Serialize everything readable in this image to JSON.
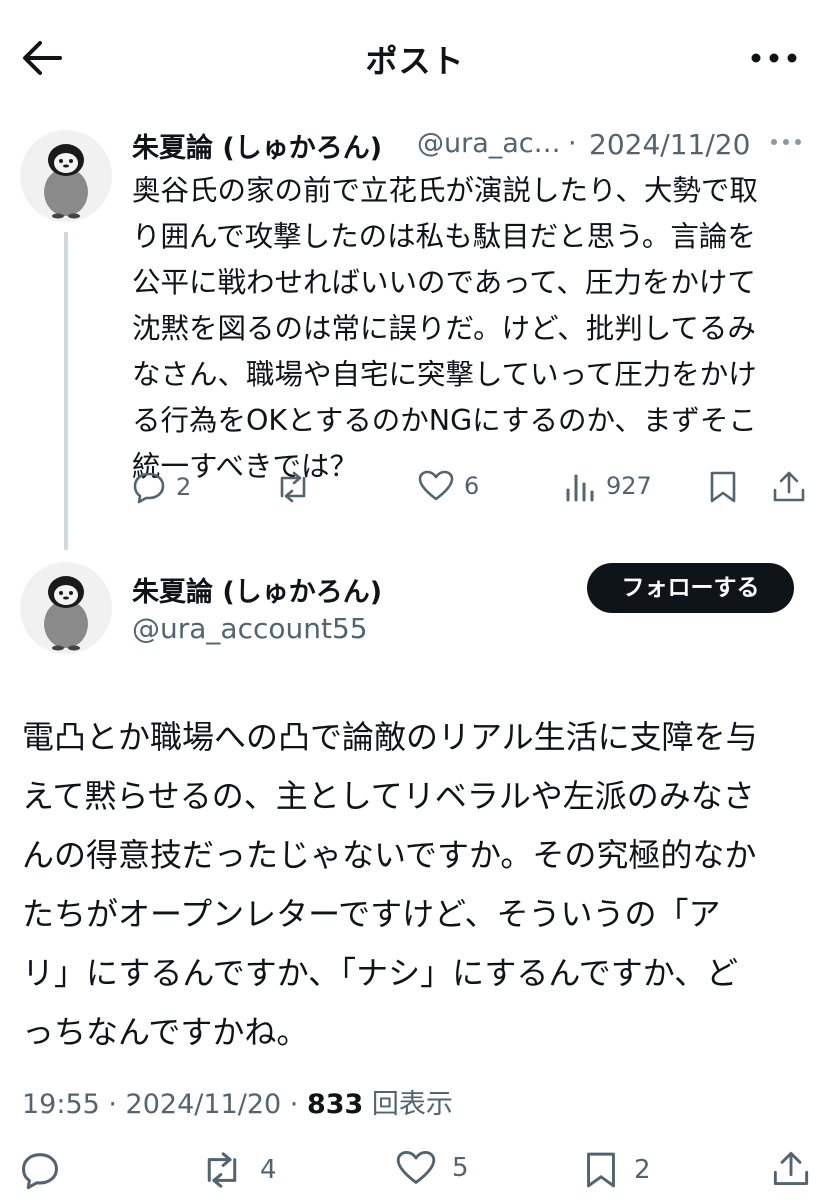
{
  "header": {
    "title": "ポスト",
    "back_icon": "arrow-left-icon",
    "more_icon": "more-horizontal-icon"
  },
  "reply_tweet": {
    "name": "朱夏論 (しゅかろん)",
    "handle": "@ura_ac…",
    "dot": "·",
    "date": "2024/11/20",
    "text": "奥谷氏の家の前で立花氏が演説したり、大勢で取\nり囲んで攻撃したのは私も駄目だと思う。言論を\n公平に戦わせればいいのであって、圧力をかけて\n沈黙を図るのは常に誤りだ。けど、批判してるみ\nなさん、職場や自宅に突撃していって圧力をかけ\nる行為をOKとするのかNGにするのか、まずそこ\n統一すべきでは？",
    "replies": "2",
    "likes": "6",
    "views": "927"
  },
  "main_tweet": {
    "name": "朱夏論 (しゅかろん)",
    "handle": "@ura_account55",
    "follow_label": "フォローする",
    "text": "電凸とか職場への凸で論敵のリアル生活に支障を与\nえて黙らせるの、主としてリベラルや左派のみなさ\nんの得意技だったじゃないですか。その究極的なか\nたちがオープンレターですけど、そういうの「ア\nリ」にするんですか、「ナシ」にするんですか、ど\nっちなんですかね。",
    "time": "19:55 · 2024/11/20 · ",
    "view_count": "833",
    "view_label": " 回表示",
    "retweets": "4",
    "likes": "5",
    "bookmarks": "2"
  },
  "colors": {
    "text": "#0f1419",
    "secondary": "#536471",
    "thread_line": "#cfd9de",
    "follow_bg": "#0f1419"
  }
}
